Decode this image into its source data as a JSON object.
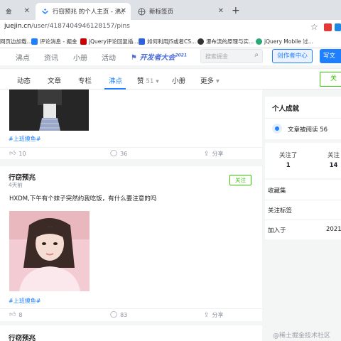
{
  "browser": {
    "tabs": [
      {
        "label": "金",
        "active": false
      },
      {
        "label": "行窃预兆 的个人主页 - 沸点 - 掘",
        "active": true
      },
      {
        "label": "新标签页",
        "active": false
      }
    ],
    "new_tab": "+",
    "url_host": "juejin.cn",
    "url_path": "/user/4187404946128157/pins",
    "bookmarks": [
      "网页边加载...",
      "评论消息 - 掘金",
      "jQuery评论回复插...",
      "如何利用JS或者CS...",
      "瀑布流的原理与实...",
      "jQuery Mobile 过..."
    ]
  },
  "nav": {
    "items": [
      "沸点",
      "资讯",
      "小册",
      "活动"
    ],
    "conference": "开发者大会",
    "conference_year": "2021",
    "search_placeholder": "搜索掘金",
    "creator_center": "创作者中心",
    "write": "写文"
  },
  "subnav": {
    "items": [
      "动态",
      "文章",
      "专栏",
      "沸点",
      "赞",
      "小册",
      "更多"
    ],
    "like_count": "51",
    "follow": "关"
  },
  "posts": [
    {
      "hashtag": "#上班摸鱼#",
      "likes": "10",
      "comments": "36",
      "share": "分享"
    },
    {
      "author": "行窃预兆",
      "time": "4天前",
      "follow": "关注",
      "text": "HXDM,下午有个妹子突然约我吃饭，有什么要注意的吗",
      "hashtag": "#上班摸鱼#",
      "likes": "8",
      "comments": "83",
      "share": "分享"
    },
    {
      "author": "行窃预兆"
    }
  ],
  "sidebar": {
    "achievements_title": "个人成就",
    "read_label": "文章被阅读",
    "read_count": "56",
    "following_label": "关注了",
    "following_count": "1",
    "followers_label": "关注",
    "followers_count": "14",
    "collections": "收藏集",
    "tags": "关注标签",
    "joined_label": "加入于",
    "joined_value": "2021"
  },
  "watermark": "@稀土掘金技术社区",
  "colors": {
    "accent": "#1e80ff",
    "follow_green": "#37c700"
  }
}
